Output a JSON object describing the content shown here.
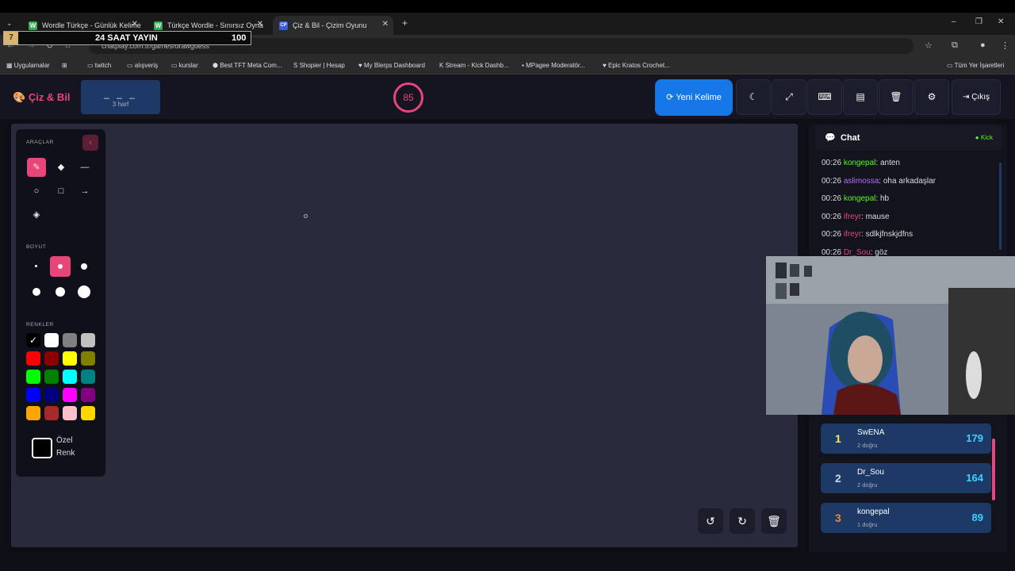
{
  "browser": {
    "tabs": [
      {
        "title": "Wordle Türkçe - Günlük Kelime",
        "favicon": "W"
      },
      {
        "title": "Türkçe Wordle - Sınırsız Oyna",
        "favicon": "W"
      },
      {
        "title": "Çiz & Bil - Çizim Oyunu",
        "favicon": "CP"
      }
    ],
    "url": "chatplay.com.tr/games/drawguess",
    "bookmarks": [
      "Uygulamalar",
      "twitch",
      "alışveriş",
      "kurslar",
      "Best TFT Meta Com...",
      "Shopier | Hesap",
      "My Blerps Dashboard",
      "Stream - Kick Dashb...",
      "MPagee Moderatör...",
      "Epic Kratos Crochet...",
      "Tüm Yer İşaretleri"
    ]
  },
  "stream_overlay": {
    "badge": "7",
    "title": "24 SAAT YAYIN",
    "count": "100"
  },
  "header": {
    "brand": "Çiz & Bil",
    "word_mask": "_ _ _",
    "word_hint": "3 harf",
    "timer": "85",
    "new_word_label": "Yeni Kelime",
    "exit_label": "Çıkış"
  },
  "tools": {
    "tools_title": "ARAÇLAR",
    "size_title": "BOYUT",
    "colors_title": "RENKLER",
    "custom_color_label": "Özel Renk",
    "colors": [
      "#000000",
      "#ffffff",
      "#808080",
      "#c0c0c0",
      "#ff0000",
      "#8b0000",
      "#ffff00",
      "#808000",
      "#00ff00",
      "#008000",
      "#00ffff",
      "#008080",
      "#0000ff",
      "#000080",
      "#ff00ff",
      "#800080",
      "#ffa500",
      "#a52a2a",
      "#ffc0cb",
      "#ffd700"
    ]
  },
  "chat": {
    "title": "Chat",
    "platform": "Kick",
    "messages": [
      {
        "time": "00:26",
        "user": "kongepal",
        "color": "#53fc18",
        "text": ": anten"
      },
      {
        "time": "00:26",
        "user": "aslimossa",
        "color": "#b86bff",
        "text": ": oha arkadaşlar"
      },
      {
        "time": "00:26",
        "user": "kongepal",
        "color": "#53fc18",
        "text": ": hb"
      },
      {
        "time": "00:26",
        "user": "ifreyr",
        "color": "#e8457a",
        "text": ": mause"
      },
      {
        "time": "00:26",
        "user": "ifreyr",
        "color": "#e8457a",
        "text": ": sdlkjfnskjdfns"
      },
      {
        "time": "00:26",
        "user": "Dr_Sou",
        "color": "#e8457a",
        "text": ": göz"
      }
    ]
  },
  "leaderboard": [
    {
      "rank": "1",
      "name": "SwENA",
      "correct": "2 doğru",
      "score": "179",
      "rank_color": "#ffe45c"
    },
    {
      "rank": "2",
      "name": "Dr_Sou",
      "correct": "2 doğru",
      "score": "164",
      "rank_color": "#c9d6e8"
    },
    {
      "rank": "3",
      "name": "kongepal",
      "correct": "1 doğru",
      "score": "89",
      "rank_color": "#e8893a"
    }
  ]
}
